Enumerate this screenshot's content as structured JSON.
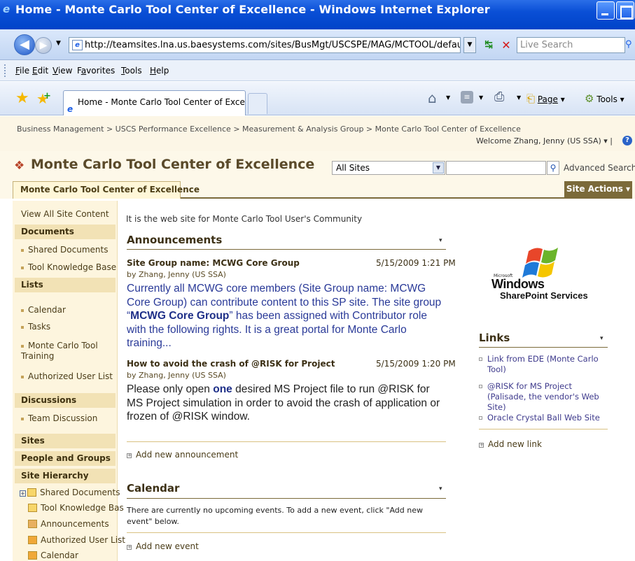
{
  "window": {
    "title": "Home - Monte Carlo Tool Center of Excellence - Windows Internet Explorer"
  },
  "address": {
    "url": "http://teamsites.lna.us.baesystems.com/sites/BusMgt/USCSPE/MAG/MCTOOL/default.aspx",
    "search_placeholder": "Live Search"
  },
  "menu": [
    {
      "label": "File",
      "key": "F",
      "rest": "ile"
    },
    {
      "label": "Edit",
      "key": "E",
      "rest": "dit"
    },
    {
      "label": "View",
      "key": "V",
      "rest": "iew"
    },
    {
      "label": "Favorites",
      "key": "a",
      "rest": "vorites"
    },
    {
      "label": "Tools",
      "key": "T",
      "rest": "ools"
    },
    {
      "label": "Help",
      "key": "H",
      "rest": "elp"
    }
  ],
  "commandbar": {
    "tab_label": "Home - Monte Carlo Tool Center of Excell...",
    "page_label": "Page",
    "tools_label": "Tools"
  },
  "sharepoint": {
    "breadcrumb": "Business Management > USCS Performance Excellence > Measurement & Analysis Group > Monte Carlo Tool Center of Excellence",
    "welcome": "Welcome Zhang, Jenny (US SSA) ▾ |",
    "site_title": "Monte Carlo Tool Center of Excellence",
    "search_scope": "All Sites",
    "advanced_search": "Advanced Search",
    "topnav_tab": "Monte Carlo Tool Center of Excellence",
    "site_actions": "Site Actions ▾"
  },
  "leftnav": {
    "view_all": "View All Site Content",
    "documents_header": "Documents",
    "documents": [
      "Shared Documents",
      "Tool Knowledge Base"
    ],
    "lists_header": "Lists",
    "lists": [
      "Calendar",
      "Tasks",
      "Monte Carlo Tool Training",
      "Authorized User List"
    ],
    "discussions_header": "Discussions",
    "discussions": [
      "Team Discussion"
    ],
    "sites_header": "Sites",
    "people_header": "People and Groups",
    "hierarchy_header": "Site Hierarchy",
    "hierarchy": [
      "Shared Documents",
      "Tool Knowledge Bas",
      "Announcements",
      "Authorized User List",
      "Calendar"
    ]
  },
  "main": {
    "intro": "It is the web site for Monte Carlo Tool User's Community",
    "announcements_title": "Announcements",
    "announcements": [
      {
        "title": "Site Group name: MCWG Core Group",
        "date": "5/15/2009 1:21 PM",
        "by": "by Zhang, Jenny (US SSA)",
        "body_1": "Currently all MCWG core members (Site Group name: MCWG Core Group) can contribute content to this SP site. The site group “",
        "body_bold": "MCWG Core Group",
        "body_2": "” has been assigned with Contributor role with the following rights. It is a great portal for Monte Carlo training..."
      },
      {
        "title": "How to avoid the crash of @RISK for Project",
        "date": "5/15/2009 1:20 PM",
        "by": "by Zhang, Jenny (US SSA)",
        "body_1": "Please only open ",
        "body_bold": "one",
        "body_2": " desired MS Project file to run @RISK for MS Project simulation in order to avoid the crash of application or frozen of @RISK window."
      }
    ],
    "add_announcement": "Add new announcement",
    "calendar_title": "Calendar",
    "calendar_text": "There are currently no upcoming events. To add a new event, click \"Add new event\" below.",
    "add_event": "Add new event"
  },
  "right": {
    "logo_microsoft": "Microsoft",
    "logo_windows": "Windows",
    "logo_sps": "SharePoint Services",
    "links_title": "Links",
    "links": [
      "Link from EDE (Monte Carlo Tool)",
      "@RISK for MS Project (Palisade, the vendor's Web Site)",
      "Oracle Crystal Ball Web Site"
    ],
    "add_link": "Add new link"
  },
  "colors": {
    "titlebar": "#0a4fd6",
    "sp_accent": "#7b6a3a",
    "nav_header_bg": "#f2e2b5",
    "ann_body_text": "#2a3a98"
  }
}
